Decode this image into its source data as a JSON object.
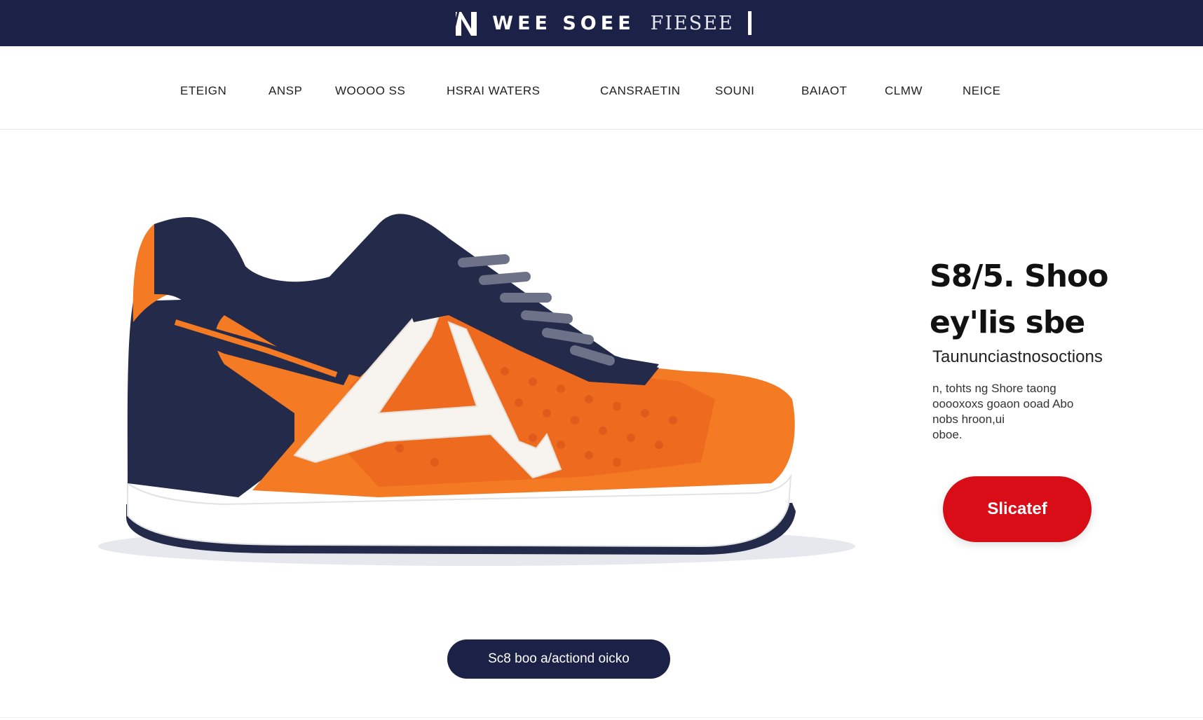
{
  "header": {
    "brand_name": "WEE SOEE",
    "brand_tagline": "FIESEE",
    "brand_icon": "shoe-brand-logo-icon",
    "background_color": "#1b2147"
  },
  "nav": {
    "items": [
      {
        "label": "ETEIGN"
      },
      {
        "label": "ANSP"
      },
      {
        "label": "WOOOO SS"
      },
      {
        "label": "HSRAI WATERS"
      },
      {
        "label": "CANSRAETIN"
      },
      {
        "label": "SOUNI"
      },
      {
        "label": "BAIAOT"
      },
      {
        "label": "CLMW"
      },
      {
        "label": "NEICE"
      }
    ]
  },
  "hero": {
    "image": "orange-navy-sneaker-product-image",
    "title_line1": "S8/5. Shoo",
    "title_line2": "ey'lis sbe",
    "subtitle": "Taununciastnosoctions",
    "description_lines": [
      "n, tohts ng Shore taong",
      "ooooxoxs goaon ooad Abo",
      "nobs hroon,ui",
      "oboe."
    ],
    "cta_label": "Slicatef",
    "cta_color": "#d80d17"
  },
  "secondary_cta": {
    "label": "Sc8 boo a/actiond oicko",
    "color": "#1b2147"
  },
  "colors": {
    "shoe_orange": "#f47a23",
    "shoe_navy": "#232a4a",
    "sole_white": "#ffffff"
  }
}
